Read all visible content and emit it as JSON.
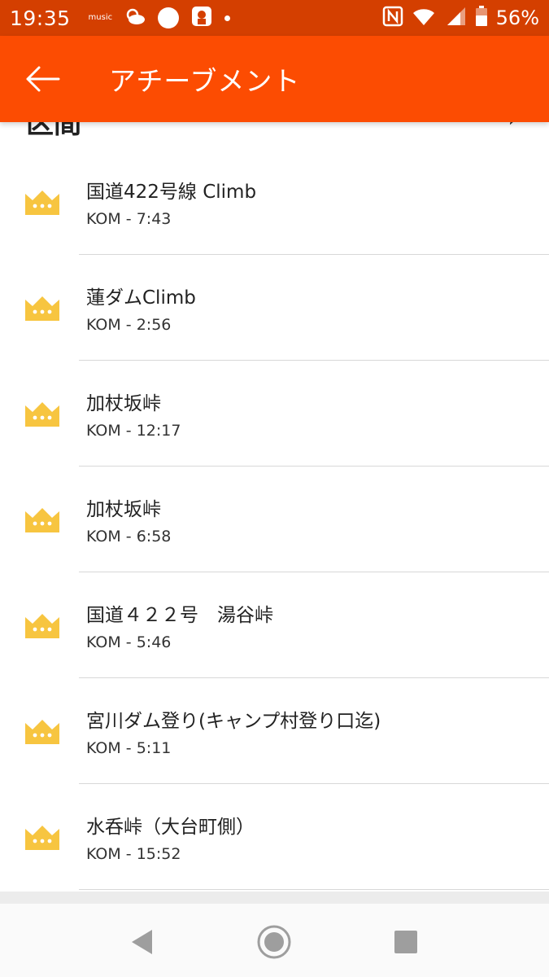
{
  "status_bar": {
    "time": "19:35",
    "music_label": "music",
    "battery": "56%"
  },
  "app_bar": {
    "title": "アチーブメント"
  },
  "section_peek": {
    "title": "区間",
    "chevron": "›"
  },
  "achievements": [
    {
      "title": "国道422号線 Climb",
      "result": "KOM - 7:43",
      "icon": "crown-icon"
    },
    {
      "title": "蓮ダムClimb",
      "result": "KOM - 2:56",
      "icon": "crown-icon"
    },
    {
      "title": "加杖坂峠",
      "result": "KOM - 12:17",
      "icon": "crown-icon"
    },
    {
      "title": "加杖坂峠",
      "result": "KOM - 6:58",
      "icon": "crown-icon"
    },
    {
      "title": "国道４２２号　湯谷峠",
      "result": "KOM - 5:46",
      "icon": "crown-icon"
    },
    {
      "title": "宮川ダム登り(キャンプ村登り口迄)",
      "result": "KOM - 5:11",
      "icon": "crown-icon"
    },
    {
      "title": "水呑峠（大台町側）",
      "result": "KOM - 15:52",
      "icon": "crown-icon"
    }
  ],
  "nav_bar": {
    "back": "back-triangle-icon",
    "home": "home-circle-icon",
    "recents": "recents-square-icon"
  },
  "colors": {
    "status_bar": "#d43f00",
    "app_bar": "#fc4c02",
    "crown": "#f7c540"
  }
}
